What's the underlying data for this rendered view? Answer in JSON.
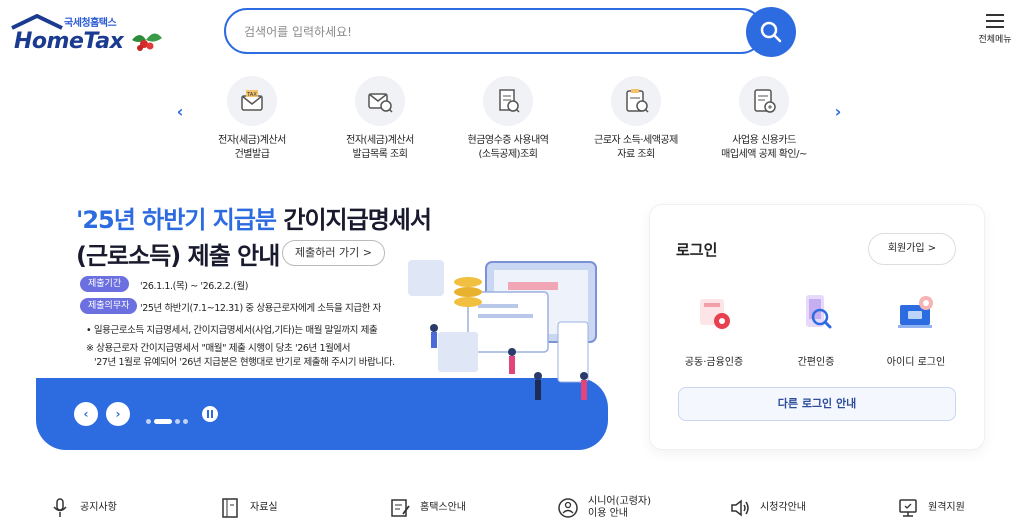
{
  "header": {
    "logo_kr": "국세청홈택스",
    "logo_en": "HomeTax",
    "search_placeholder": "검색어를 입력하세요!",
    "menu_label": "전체메뉴"
  },
  "quick_menu": {
    "items": [
      {
        "label": "전자(세금)계산서\n건별발급",
        "icon": "tax-invoice-icon"
      },
      {
        "label": "전자(세금)계산서\n발급목록 조회",
        "icon": "tax-invoice-search-icon"
      },
      {
        "label": "현금영수증 사용내역\n(소득공제)조회",
        "icon": "receipt-icon"
      },
      {
        "label": "근로자 소득·세액공제\n자료 조회",
        "icon": "document-search-icon"
      },
      {
        "label": "사업용 신용카드\n매입세액 공제 확인/~",
        "icon": "card-document-icon"
      }
    ]
  },
  "banner": {
    "title_blue": "'25년 하반기 지급분",
    "title_black": " 간이지급명세서",
    "title_line2": "(근로소득) 제출 안내",
    "go_button": "제출하러 가기 >",
    "period_pill": "제출기간",
    "period_text": "'26.1.1.(목) ~ '26.2.2.(월)",
    "obligor_pill": "제출의무자",
    "obligor_text": "'25년 하반기(7.1~12.31) 중 상용근로자에게 소득을 지급한 자",
    "bullet": "• 일용근로소득 지급명세서, 간이지급명세서(사업,기타)는 매월 말일까지 제출",
    "note_line1": "※ 상용근로자 간이지급명세서 \"매월\" 제출 시행이 당초 '26년 1월에서",
    "note_line2": "'27년 1월로 유예되어 '26년 지급분은 현행대로 반기로 제출해 주시기 바랍니다."
  },
  "login": {
    "title": "로그인",
    "join_button": "회원가입  >",
    "options": [
      {
        "label": "공동·금융인증",
        "icon": "certificate-icon"
      },
      {
        "label": "간편인증",
        "icon": "phone-auth-icon"
      },
      {
        "label": "아이디 로그인",
        "icon": "id-login-icon"
      }
    ],
    "other_button": "다른 로그인 안내"
  },
  "bottom_bar": [
    {
      "label": "공지사항",
      "icon": "microphone-icon"
    },
    {
      "label": "자료실",
      "icon": "archive-icon"
    },
    {
      "label": "홈택스안내",
      "icon": "guide-icon"
    },
    {
      "label": "시니어(고령자)\n이용 안내",
      "icon": "senior-icon"
    },
    {
      "label": "시청각안내",
      "icon": "speaker-icon"
    },
    {
      "label": "원격지원",
      "icon": "remote-support-icon"
    }
  ],
  "colors": {
    "primary": "#2d6be0",
    "navy": "#1a3b8f",
    "pill": "#6b6fe0"
  }
}
